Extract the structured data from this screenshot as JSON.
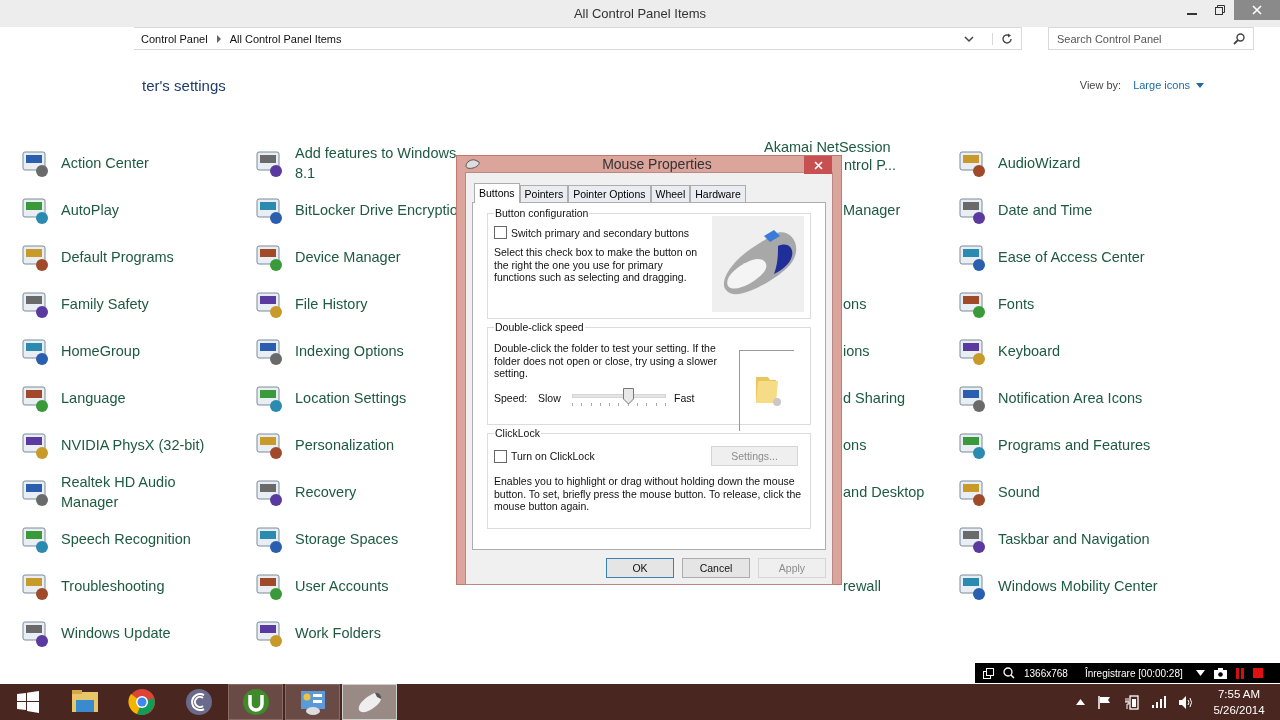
{
  "window": {
    "title": "All Control Panel Items"
  },
  "address_bar": {
    "breadcrumb": [
      "Control Panel",
      "All Control Panel Items"
    ]
  },
  "search": {
    "placeholder": "Search Control Panel"
  },
  "heading": "ter's settings",
  "view_by": {
    "label": "View by:",
    "value": "Large icons"
  },
  "columns": [
    [
      {
        "label": "Action Center"
      },
      {
        "label": "AutoPlay"
      },
      {
        "label": "Default Programs"
      },
      {
        "label": "Family Safety"
      },
      {
        "label": "HomeGroup"
      },
      {
        "label": "Language"
      },
      {
        "label": "NVIDIA PhysX (32-bit)"
      },
      {
        "label": "Realtek HD Audio Manager"
      },
      {
        "label": "Speech Recognition"
      },
      {
        "label": "Troubleshooting"
      },
      {
        "label": "Windows Update"
      }
    ],
    [
      {
        "label": "Add features to Windows 8.1"
      },
      {
        "label": "BitLocker Drive Encryptio"
      },
      {
        "label": "Device Manager"
      },
      {
        "label": "File History"
      },
      {
        "label": "Indexing Options"
      },
      {
        "label": "Location Settings"
      },
      {
        "label": "Personalization"
      },
      {
        "label": "Recovery"
      },
      {
        "label": "Storage Spaces"
      },
      {
        "label": "User Accounts"
      },
      {
        "label": "Work Folders"
      }
    ],
    [
      {
        "label": "Akamai NetSession",
        "continued": "ntrol P..."
      },
      {
        "fragment": "Manager"
      },
      {},
      {
        "fragment": "ons"
      },
      {
        "fragment": "ions"
      },
      {
        "fragment": "d Sharing"
      },
      {
        "fragment": "ons"
      },
      {
        "fragment": "and Desktop"
      },
      {},
      {
        "fragment": "rewall"
      }
    ],
    [
      {
        "label": "AudioWizard"
      },
      {
        "label": "Date and Time"
      },
      {
        "label": "Ease of Access Center"
      },
      {
        "label": "Fonts"
      },
      {
        "label": "Keyboard"
      },
      {
        "label": "Notification Area Icons"
      },
      {
        "label": "Programs and Features"
      },
      {
        "label": "Sound"
      },
      {
        "label": "Taskbar and Navigation"
      },
      {
        "label": "Windows Mobility Center"
      }
    ]
  ],
  "dialog": {
    "title": "Mouse Properties",
    "tabs": [
      {
        "label": "Buttons",
        "selected": true
      },
      {
        "label": "Pointers",
        "selected": false
      },
      {
        "label": "Pointer Options",
        "selected": false
      },
      {
        "label": "Wheel",
        "selected": false
      },
      {
        "label": "Hardware",
        "selected": false
      }
    ],
    "button_config": {
      "title": "Button configuration",
      "checkbox": {
        "label": "Switch primary and secondary buttons",
        "checked": false
      },
      "description": "Select this check box to make the button on the right the one you use for primary functions such as selecting and dragging."
    },
    "double_click": {
      "title": "Double-click speed",
      "description": "Double-click the folder to test your setting. If the folder does not open or close, try using a slower setting.",
      "speed_label": "Speed:",
      "slow": "Slow",
      "fast": "Fast",
      "level": 0.6
    },
    "clicklock": {
      "title": "ClickLock",
      "checkbox": {
        "label": "Turn on ClickLock",
        "checked": false
      },
      "settings_button": {
        "label": "Settings...",
        "disabled": true
      },
      "description": "Enables you to highlight or drag without holding down the mouse button. To set, briefly press the mouse button. To release, click the mouse button again."
    },
    "buttons": [
      {
        "label": "OK",
        "disabled": false
      },
      {
        "label": "Cancel",
        "disabled": false
      },
      {
        "label": "Apply",
        "disabled": true
      }
    ]
  },
  "recorder": {
    "resolution": "1366x768",
    "status": "Înregistrare [00:00:28]"
  },
  "taskbar": {
    "apps": [
      {
        "open": false,
        "selected": false
      },
      {
        "open": false,
        "selected": false
      },
      {
        "open": false,
        "selected": false
      },
      {
        "open": true,
        "selected": false
      },
      {
        "open": true,
        "selected": false
      },
      {
        "open": true,
        "selected": true
      }
    ],
    "clock": {
      "time": "7:55 AM",
      "date": "5/26/2014"
    }
  }
}
